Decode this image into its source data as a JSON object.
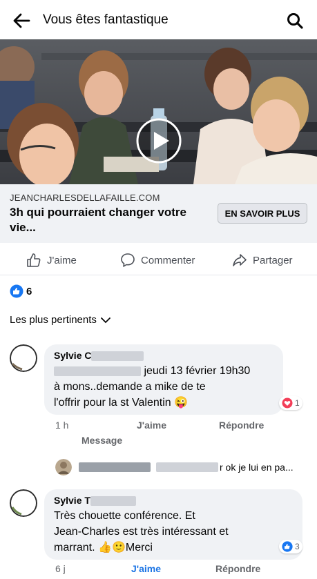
{
  "header": {
    "title": "Vous êtes fantastique"
  },
  "link_card": {
    "domain": "JEANCHARLESDELLAFAILLE.COM",
    "headline_line1": "3h qui pourraient changer votre",
    "headline_line2": "vie...",
    "cta_label": "EN SAVOIR PLUS"
  },
  "actions": {
    "like": "J'aime",
    "comment": "Commenter",
    "share": "Partager"
  },
  "reactions": {
    "count": "6"
  },
  "sort": {
    "label": "Les plus pertinents"
  },
  "comments": [
    {
      "author_visible": "Sylvie C",
      "line1_visible": " jeudi 13 février 19h30",
      "line2": "à mons..demande a mike de te",
      "line3": "l'offrir pour la st Valentin 😜",
      "reaction_count": "1",
      "time": "1 h",
      "like_label": "J'aime",
      "reply_label": "Répondre",
      "message_label": "Message"
    },
    {
      "author_visible": "Sylvie T",
      "line1": "Très chouette conférence. Et",
      "line2": "Jean-Charles est très intéressant et",
      "line3": "marrant. 👍🙂Merci",
      "reaction_count": "3",
      "time": "6 j",
      "like_label": "J'aime",
      "reply_label": "Répondre"
    }
  ],
  "reply_preview": {
    "text_visible": "r ok je lui en pa..."
  },
  "colors": {
    "fb_blue": "#1877f2",
    "like_blue": "#1b74e4",
    "muted": "#65676b",
    "bubble": "#f0f2f5",
    "heart_red": "#f33e58"
  },
  "icons": [
    "back-arrow-icon",
    "search-icon",
    "play-icon",
    "like-icon",
    "comment-icon",
    "share-icon",
    "chevron-down-icon",
    "heart-icon"
  ]
}
